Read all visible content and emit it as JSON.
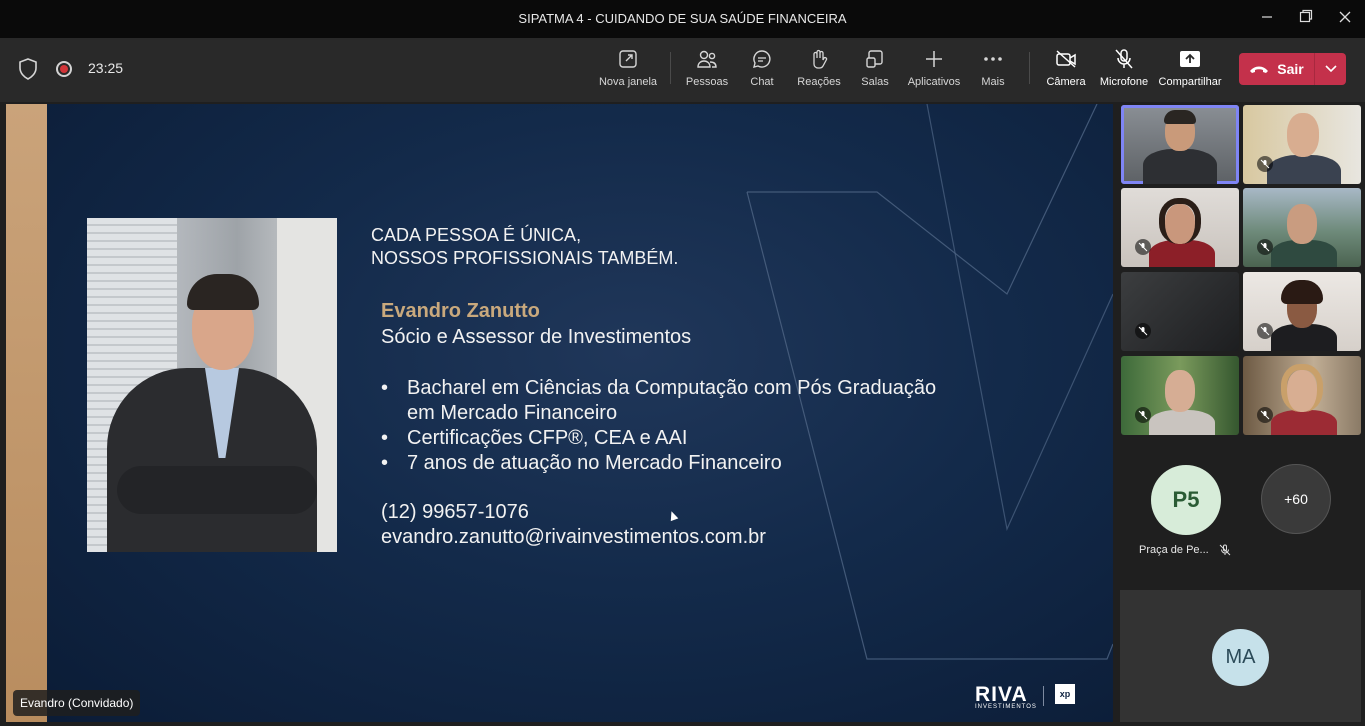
{
  "window": {
    "title": "SIPATMA 4 - CUIDANDO DE SUA SAÚDE FINANCEIRA",
    "controls": [
      "minimize",
      "maximize",
      "close"
    ]
  },
  "toolbar": {
    "timer": "23:25",
    "buttons": [
      {
        "label": "Nova janela",
        "icon": "open-window-icon"
      },
      {
        "label": "Pessoas",
        "icon": "people-icon"
      },
      {
        "label": "Chat",
        "icon": "chat-icon"
      },
      {
        "label": "Reações",
        "icon": "reactions-icon"
      },
      {
        "label": "Salas",
        "icon": "rooms-icon"
      },
      {
        "label": "Aplicativos",
        "icon": "plus-icon"
      },
      {
        "label": "Mais",
        "icon": "more-icon"
      },
      {
        "label": "Câmera",
        "icon": "camera-off-icon"
      },
      {
        "label": "Microfone",
        "icon": "mic-off-icon"
      },
      {
        "label": "Compartilhar",
        "icon": "share-icon"
      }
    ],
    "leave_label": "Sair",
    "leave_color": "#c4314b"
  },
  "slide": {
    "headline_1": "CADA PESSOA É ÚNICA,",
    "headline_2": "NOSSOS PROFISSIONAIS TAMBÉM.",
    "name": "Evandro Zanutto",
    "role": "Sócio e Assessor de Investimentos",
    "bullets": [
      {
        "line1": "Bacharel em Ciências da Computação com Pós Graduação",
        "line2": "em Mercado Financeiro"
      },
      {
        "line1": "Certificações CFP®, CEA e AAI"
      },
      {
        "line1": "7 anos de atuação no Mercado Financeiro"
      }
    ],
    "phone": "(12) 99657-1076",
    "email": "evandro.zanutto@rivainvestimentos.com.br",
    "logo_main": "RIVA",
    "logo_sub": "INVESTIMENTOS",
    "logo_xp": "xp",
    "accent_color": "#c9a97d"
  },
  "presenter": {
    "name_chip": "Evandro (Convidado)"
  },
  "participants": {
    "p5_initials": "P5",
    "p5_name": "Praça de Pe...",
    "more_count": "+60",
    "ma_initials": "MA"
  }
}
